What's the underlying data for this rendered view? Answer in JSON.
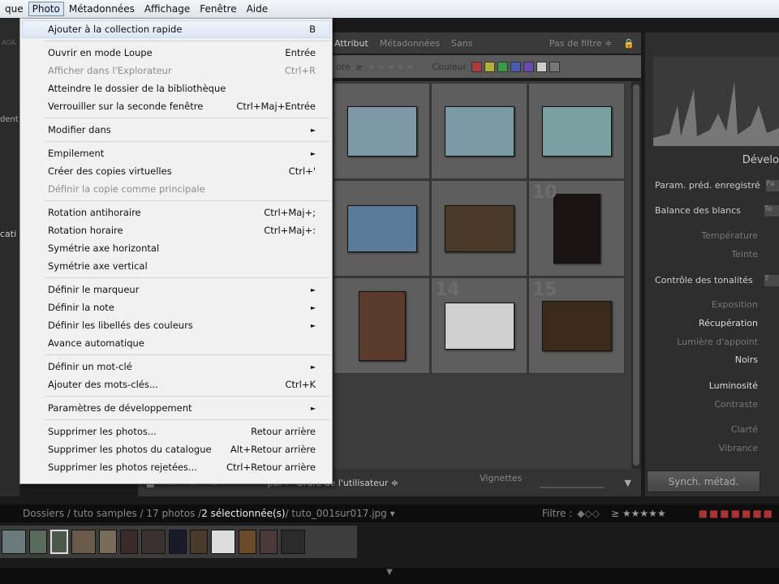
{
  "menubar": {
    "items": [
      "que",
      "Photo",
      "Métadonnées",
      "Affichage",
      "Fenêtre",
      "Aide"
    ],
    "active": "Photo"
  },
  "menu": {
    "groups": [
      [
        {
          "label": "Ajouter à la collection rapide",
          "shortcut": "B",
          "highlighted": true
        }
      ],
      [
        {
          "label": "Ouvrir en mode Loupe",
          "shortcut": "Entrée"
        },
        {
          "label": "Afficher dans l'Explorateur",
          "shortcut": "Ctrl+R",
          "disabled": true
        },
        {
          "label": "Atteindre le dossier de la bibliothèque",
          "shortcut": ""
        },
        {
          "label": "Verrouiller sur la seconde fenêtre",
          "shortcut": "Ctrl+Maj+Entrée"
        }
      ],
      [
        {
          "label": "Modifier dans",
          "submenu": true
        }
      ],
      [
        {
          "label": "Empilement",
          "submenu": true
        },
        {
          "label": "Créer des copies virtuelles",
          "shortcut": "Ctrl+'"
        },
        {
          "label": "Définir la copie comme principale",
          "disabled": true
        }
      ],
      [
        {
          "label": "Rotation antihoraire",
          "shortcut": "Ctrl+Maj+;"
        },
        {
          "label": "Rotation horaire",
          "shortcut": "Ctrl+Maj+:"
        },
        {
          "label": "Symétrie axe horizontal"
        },
        {
          "label": "Symétrie axe vertical"
        }
      ],
      [
        {
          "label": "Définir le marqueur",
          "submenu": true
        },
        {
          "label": "Définir la note",
          "submenu": true
        },
        {
          "label": "Définir les libellés des couleurs",
          "submenu": true
        },
        {
          "label": "Avance automatique"
        }
      ],
      [
        {
          "label": "Définir un mot-clé",
          "submenu": true
        },
        {
          "label": "Ajouter des mots-clés...",
          "shortcut": "Ctrl+K"
        }
      ],
      [
        {
          "label": "Paramètres de développement",
          "submenu": true
        }
      ],
      [
        {
          "label": "Supprimer les photos...",
          "shortcut": "Retour arrière"
        },
        {
          "label": "Supprimer les photos du catalogue",
          "shortcut": "Alt+Retour arrière"
        },
        {
          "label": "Supprimer les photos rejetées...",
          "shortcut": "Ctrl+Retour arrière"
        }
      ]
    ]
  },
  "filterbar": {
    "items": [
      "Attribut",
      "Métadonnées",
      "Sans"
    ],
    "filter": "Pas de filtre ≑"
  },
  "colorbar": {
    "note_label": "ote",
    "geq": "≥",
    "couleur_label": "Couleur",
    "colors": [
      "#b03a3a",
      "#b0b03a",
      "#3a9a4a",
      "#4a5ab0",
      "#6a4ab0",
      "#cccccc",
      "#777777"
    ]
  },
  "grid": {
    "cells": [
      {
        "num": "",
        "bg": "#7f98a8",
        "w": 86,
        "h": 62
      },
      {
        "num": "",
        "bg": "#7a9aa5",
        "w": 86,
        "h": 62
      },
      {
        "num": "",
        "bg": "#7aa0a0",
        "w": 86,
        "h": 62
      },
      {
        "num": "",
        "bg": "#5a7a9a",
        "w": 86,
        "h": 58
      },
      {
        "num": "",
        "bg": "#4a3a2a",
        "w": 86,
        "h": 58
      },
      {
        "num": "10",
        "bg": "#1a1512",
        "w": 58,
        "h": 86
      },
      {
        "num": "",
        "bg": "#5a3a2a",
        "w": 58,
        "h": 86
      },
      {
        "num": "14",
        "bg": "#cfcfcf",
        "w": 86,
        "h": 58
      },
      {
        "num": "15",
        "bg": "#3a2a1a",
        "w": 86,
        "h": 62
      }
    ]
  },
  "right": {
    "title": "Dévelo",
    "preset_label": "Param. préd. enregistré",
    "preset_value": "Pa",
    "wb_label": "Balance des blancs",
    "wb_value": "Te",
    "temp": "Température",
    "tint": "Teinte",
    "tone_label": "Contrôle des tonalités",
    "tone_value": "T",
    "exposure": "Exposition",
    "recovery": "Récupération",
    "fill": "Lumière d'appoint",
    "blacks": "Noirs",
    "brightness": "Luminosité",
    "contrast": "Contraste",
    "clarity": "Clarté",
    "vibrance": "Vibrance",
    "synch": "Synch. métad."
  },
  "toolbar": {
    "sort_prefix": "par :",
    "sort": "Ordre de l'utilisateur ≑",
    "thumbs": "Vignettes"
  },
  "left": {
    "a": "AOA",
    "b": "dent",
    "c": "cati"
  },
  "path": {
    "prefix": "Dossiers / tuto samples / 17 photos / ",
    "selected": "2 sélectionnée(s)",
    "file": " / tuto_001sur017.jpg ▾",
    "filtre": "Filtre :",
    "stars": "≥ ★★★★★"
  },
  "film": {
    "thumbs": [
      "#6a7a7a",
      "#5a6a5a",
      "#4a5a4a",
      "#6a5a4a",
      "#7a6a5a",
      "#3a2a2a",
      "#3a3030",
      "#1a1a2a",
      "#4a3a2a",
      "#dddddd",
      "#6a4a2a",
      "#4a3a3a",
      "#2a2a2a"
    ]
  }
}
